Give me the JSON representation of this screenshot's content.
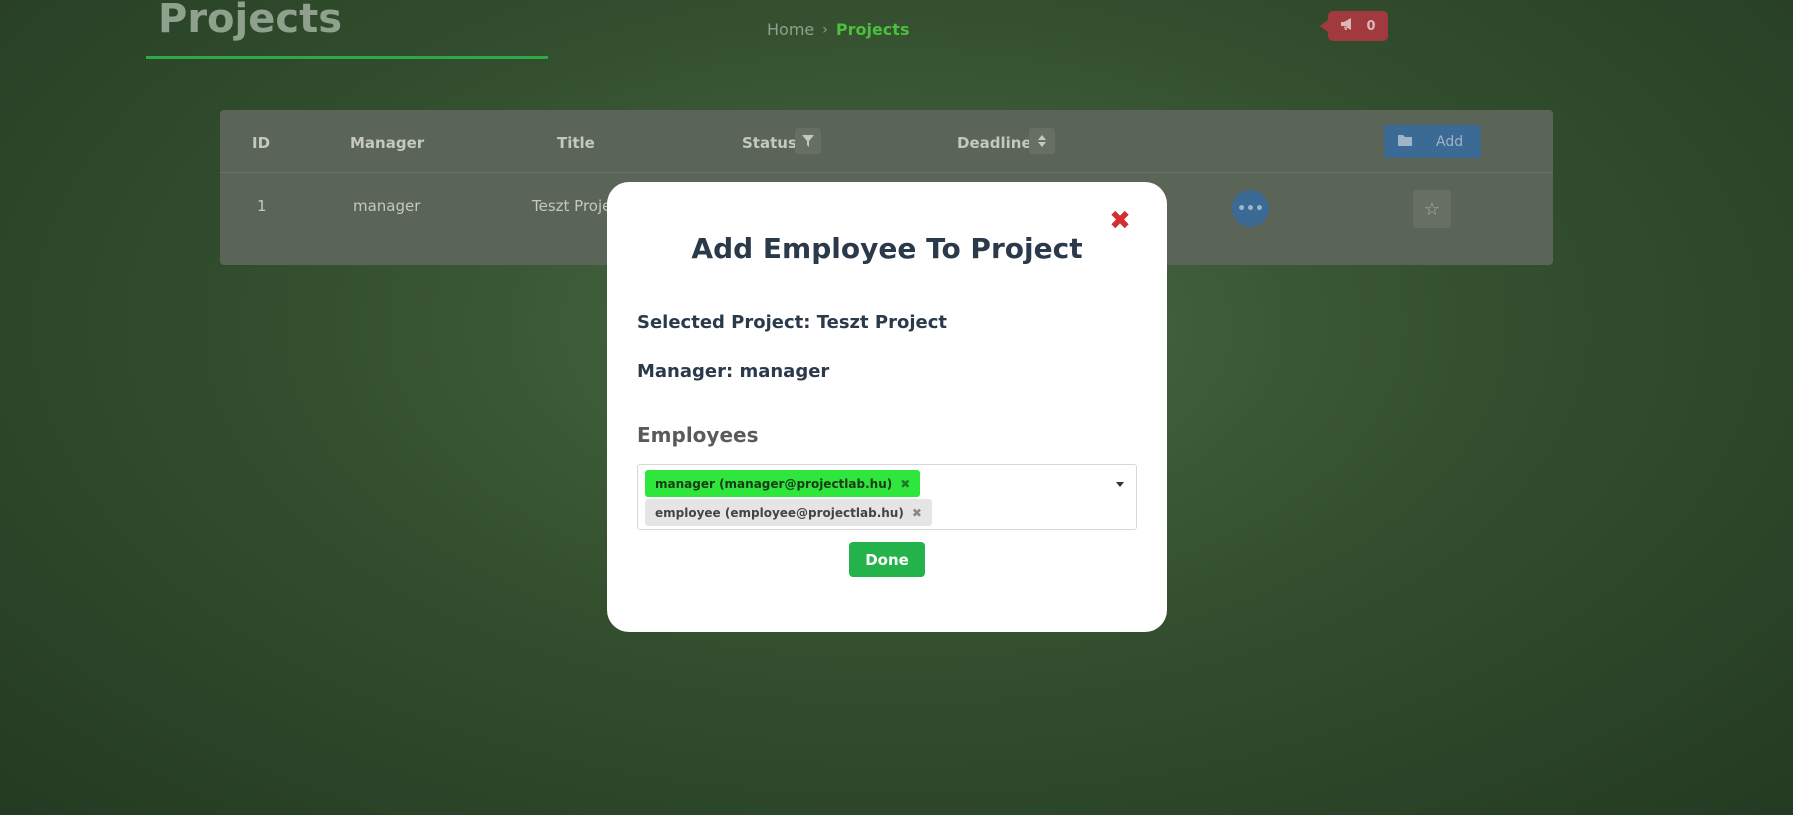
{
  "page": {
    "title": "Projects",
    "breadcrumb": {
      "home": "Home",
      "separator": "›",
      "current": "Projects"
    },
    "notifications": {
      "count": "0",
      "icon": "megaphone-icon"
    }
  },
  "table": {
    "headers": {
      "id": "ID",
      "manager": "Manager",
      "title": "Title",
      "status": "Status",
      "deadline": "Deadline"
    },
    "add_label": "Add",
    "rows": [
      {
        "id": "1",
        "manager": "manager",
        "title": "Teszt Projec"
      }
    ],
    "dots_label": "•••"
  },
  "modal": {
    "title": "Add Employee To Project",
    "close_label": "✖",
    "selected_project": "Selected Project: Teszt Project",
    "manager": "Manager: manager",
    "employees_label": "Employees",
    "tags": [
      {
        "label": "manager (manager@projectlab.hu)",
        "remove": "✖"
      },
      {
        "label": "employee (employee@projectlab.hu)",
        "remove": "✖"
      }
    ],
    "done_label": "Done"
  },
  "colors": {
    "accent_green": "#24b34a",
    "tag_green": "#2ee63c",
    "close_red": "#d32f2f",
    "title_dark": "#2b3a4a"
  }
}
